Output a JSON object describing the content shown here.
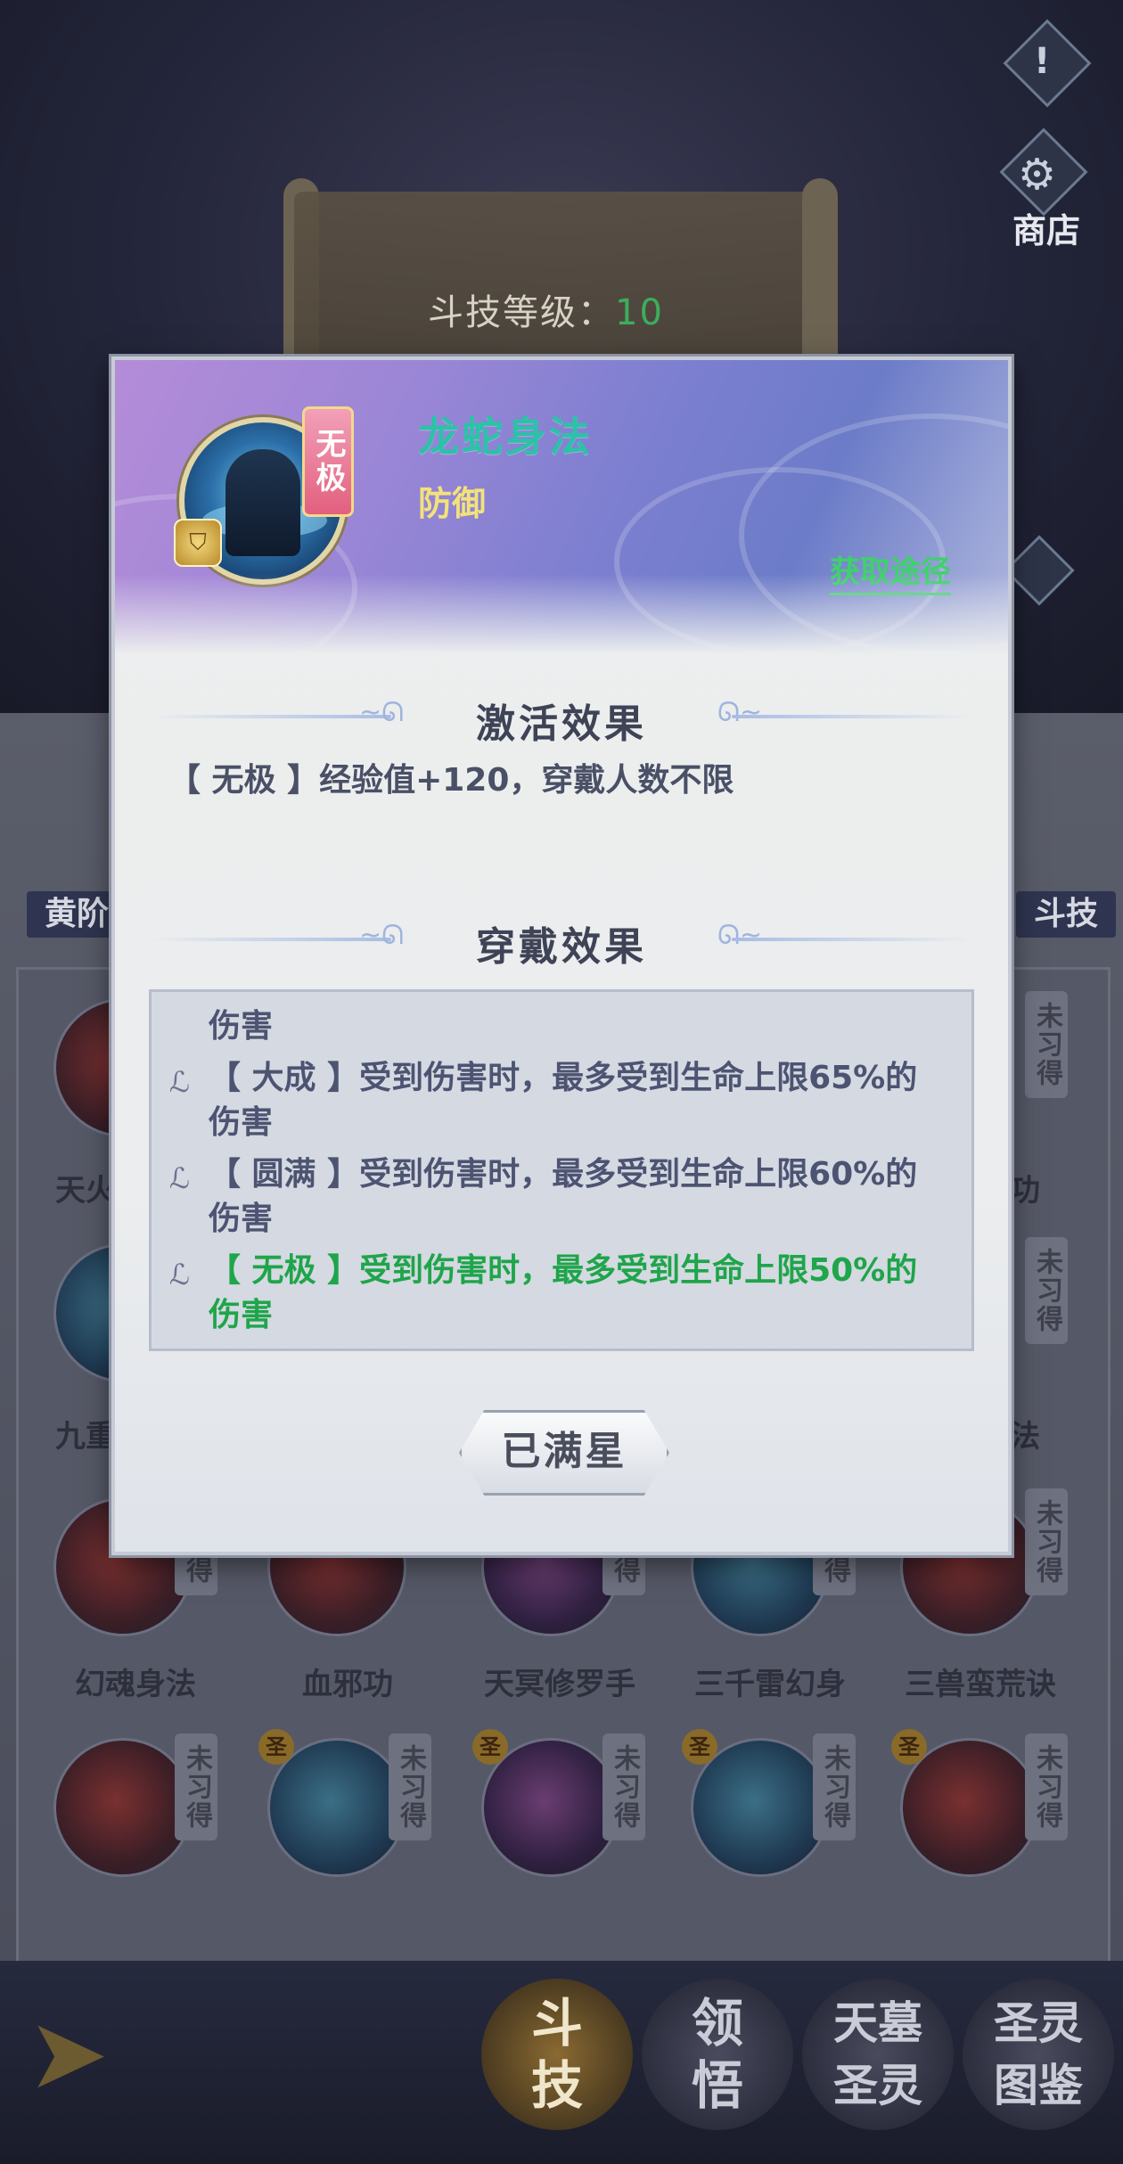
{
  "background": {
    "level_label": "斗技等级：",
    "level_value": "10",
    "shop_label": "商店",
    "warn_glyph": "!",
    "side_tabs": [
      "黄阶",
      "斗技"
    ],
    "badge_text": "未习得",
    "mini_badge": "圣",
    "skills_row_1": [
      "天火",
      "",
      "",
      "",
      "功"
    ],
    "skills_row_2": [
      "九重",
      "",
      "",
      "",
      "法"
    ],
    "skills_row_3": [
      "幻魂身法",
      "血邪功",
      "天冥修罗手",
      "三千雷幻身",
      "三兽蛮荒诀"
    ],
    "bottom_nav": [
      {
        "label_top": "斗",
        "label_bottom": "技"
      },
      {
        "label_top": "领",
        "label_bottom": "悟"
      },
      {
        "label_top": "天墓",
        "label_bottom": "圣灵"
      },
      {
        "label_top": "圣灵",
        "label_bottom": "图鉴"
      }
    ]
  },
  "modal": {
    "skill_name": "龙蛇身法",
    "skill_type": "防御",
    "rank_tag": "无极",
    "obtain_link": "获取途径",
    "activate_title": "激活效果",
    "activate_text": "【 无极 】经验值+120，穿戴人数不限",
    "wear_title": "穿戴效果",
    "wear_lines": [
      {
        "text": "伤害",
        "bullet": false
      },
      {
        "text": "【 大成 】受到伤害时，最多受到生命上限65%的",
        "bullet": true
      },
      {
        "text": "伤害",
        "bullet": false
      },
      {
        "text": "【 圆满 】受到伤害时，最多受到生命上限60%的",
        "bullet": true
      },
      {
        "text": "伤害",
        "bullet": false
      },
      {
        "text": "【 无极 】受到伤害时，最多受到生命上限50%的",
        "bullet": true
      },
      {
        "text": "伤害",
        "bullet": false
      }
    ],
    "button_label": "已满星"
  },
  "colors": {
    "skill_name": "#2bc2a8",
    "skill_type": "#f3e27a",
    "link": "#3ed16c",
    "highlight_line": "#1fa54a"
  }
}
